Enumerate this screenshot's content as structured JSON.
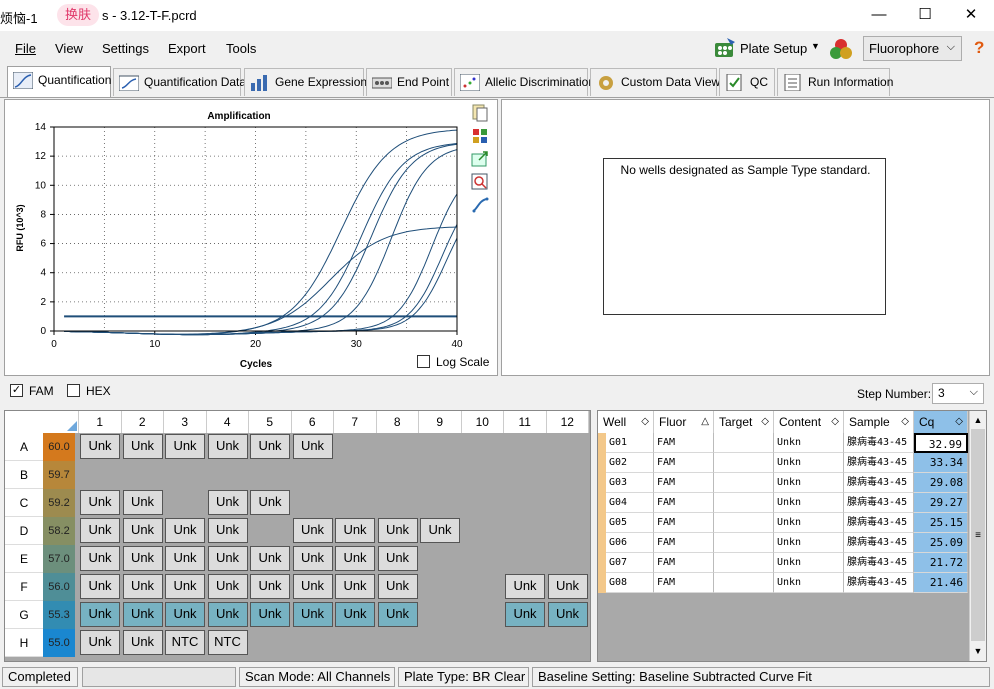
{
  "window": {
    "title_prefix": "烦恼-1",
    "skin_label": "换肤",
    "file_title": "s - 3.12-T-F.pcrd",
    "min_label": "—",
    "max_label": "☐",
    "close_label": "✕"
  },
  "menu": {
    "file": "File",
    "view": "View",
    "settings": "Settings",
    "export": "Export",
    "tools": "Tools",
    "plate_setup": "Plate Setup",
    "fluorophore": "Fluorophore",
    "help": "?"
  },
  "tabs": [
    {
      "label": "Quantification"
    },
    {
      "label": "Quantification Data"
    },
    {
      "label": "Gene Expression"
    },
    {
      "label": "End Point"
    },
    {
      "label": "Allelic Discrimination"
    },
    {
      "label": "Custom Data View"
    },
    {
      "label": "QC"
    },
    {
      "label": "Run Information"
    }
  ],
  "chart_data": {
    "type": "line",
    "title": "Amplification",
    "xlabel": "Cycles",
    "ylabel": "RFU (10^3)",
    "xlim": [
      0,
      40
    ],
    "ylim": [
      0,
      14
    ],
    "xticks": [
      0,
      10,
      20,
      30,
      40
    ],
    "yticks": [
      0,
      2,
      4,
      6,
      8,
      10,
      12,
      14
    ],
    "threshold": 1.0,
    "grid": true,
    "curves": [
      {
        "max": 13.9,
        "mid": 28.5,
        "k": 0.42
      },
      {
        "max": 13.0,
        "mid": 30.5,
        "k": 0.48
      },
      {
        "max": 13.0,
        "mid": 31.5,
        "k": 0.5
      },
      {
        "max": 12.8,
        "mid": 33.5,
        "k": 0.55
      },
      {
        "max": 7.2,
        "mid": 27.5,
        "k": 0.38
      },
      {
        "max": 11.5,
        "mid": 37.5,
        "k": 0.6
      },
      {
        "max": 10.2,
        "mid": 38.5,
        "k": 0.62
      },
      {
        "max": 9.8,
        "mid": 39.0,
        "k": 0.62
      }
    ]
  },
  "chart": {
    "log_scale_label": "Log Scale",
    "y_tick_labels": [
      "0",
      "2",
      "4",
      "6",
      "8",
      "10",
      "12",
      "14"
    ],
    "x_tick_labels": [
      "0",
      "10",
      "20",
      "30",
      "40"
    ]
  },
  "std_message": "No wells designated as Sample Type standard.",
  "filters": {
    "fam": "FAM",
    "hex": "HEX",
    "step_label": "Step Number:",
    "step_value": "3"
  },
  "plate": {
    "columns": [
      "1",
      "2",
      "3",
      "4",
      "5",
      "6",
      "7",
      "8",
      "9",
      "10",
      "11",
      "12"
    ],
    "rows": [
      {
        "label": "A",
        "temp": "60.0",
        "color": "#d4791d",
        "wells": [
          "Unk",
          "Unk",
          "Unk",
          "Unk",
          "Unk",
          "Unk",
          "",
          "",
          "",
          "",
          "",
          ""
        ],
        "blue": false
      },
      {
        "label": "B",
        "temp": "59.7",
        "color": "#b7873a",
        "wells": [
          "",
          "",
          "",
          "",
          "",
          "",
          "",
          "",
          "",
          "",
          "",
          ""
        ],
        "blue": false
      },
      {
        "label": "C",
        "temp": "59.2",
        "color": "#9d8b4f",
        "wells": [
          "Unk",
          "Unk",
          "",
          "Unk",
          "Unk",
          "",
          "",
          "",
          "",
          "",
          "",
          ""
        ],
        "blue": false
      },
      {
        "label": "D",
        "temp": "58.2",
        "color": "#868f63",
        "wells": [
          "Unk",
          "Unk",
          "Unk",
          "Unk",
          "",
          "Unk",
          "Unk",
          "Unk",
          "Unk",
          "",
          "",
          ""
        ],
        "blue": false
      },
      {
        "label": "E",
        "temp": "57.0",
        "color": "#6c8f7c",
        "wells": [
          "Unk",
          "Unk",
          "Unk",
          "Unk",
          "Unk",
          "Unk",
          "Unk",
          "Unk",
          "",
          "",
          "",
          ""
        ],
        "blue": false
      },
      {
        "label": "F",
        "temp": "56.0",
        "color": "#4f8e97",
        "wells": [
          "Unk",
          "Unk",
          "Unk",
          "Unk",
          "Unk",
          "Unk",
          "Unk",
          "Unk",
          "",
          "",
          "Unk",
          "Unk"
        ],
        "blue": false
      },
      {
        "label": "G",
        "temp": "55.3",
        "color": "#328cb2",
        "wells": [
          "Unk",
          "Unk",
          "Unk",
          "Unk",
          "Unk",
          "Unk",
          "Unk",
          "Unk",
          "",
          "",
          "Unk",
          "Unk"
        ],
        "blue": true
      },
      {
        "label": "H",
        "temp": "55.0",
        "color": "#1a87d0",
        "wells": [
          "Unk",
          "Unk",
          "NTC",
          "NTC",
          "",
          "",
          "",
          "",
          "",
          "",
          "",
          ""
        ],
        "blue": false
      }
    ]
  },
  "table": {
    "headers": [
      "Well",
      "Fluor",
      "Target",
      "Content",
      "Sample",
      "Cq"
    ],
    "rows": [
      {
        "well": "G01",
        "fluor": "FAM",
        "target": "",
        "content": "Unkn",
        "sample": "腺病毒43-45",
        "cq": "32.99"
      },
      {
        "well": "G02",
        "fluor": "FAM",
        "target": "",
        "content": "Unkn",
        "sample": "腺病毒43-45",
        "cq": "33.34"
      },
      {
        "well": "G03",
        "fluor": "FAM",
        "target": "",
        "content": "Unkn",
        "sample": "腺病毒43-45",
        "cq": "29.08"
      },
      {
        "well": "G04",
        "fluor": "FAM",
        "target": "",
        "content": "Unkn",
        "sample": "腺病毒43-45",
        "cq": "29.27"
      },
      {
        "well": "G05",
        "fluor": "FAM",
        "target": "",
        "content": "Unkn",
        "sample": "腺病毒43-45",
        "cq": "25.15"
      },
      {
        "well": "G06",
        "fluor": "FAM",
        "target": "",
        "content": "Unkn",
        "sample": "腺病毒43-45",
        "cq": "25.09"
      },
      {
        "well": "G07",
        "fluor": "FAM",
        "target": "",
        "content": "Unkn",
        "sample": "腺病毒43-45",
        "cq": "21.72"
      },
      {
        "well": "G08",
        "fluor": "FAM",
        "target": "",
        "content": "Unkn",
        "sample": "腺病毒43-45",
        "cq": "21.46"
      }
    ]
  },
  "status": {
    "state": "Completed",
    "scan_mode": "Scan Mode: All Channels",
    "plate_type": "Plate Type: BR Clear",
    "baseline": "Baseline Setting: Baseline Subtracted Curve Fit"
  }
}
